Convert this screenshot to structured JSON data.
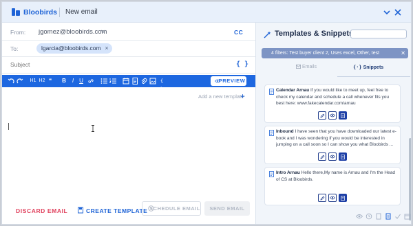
{
  "header": {
    "brand": "Bloobirds",
    "title": "New email",
    "icons": [
      "minimize-icon",
      "close-icon"
    ]
  },
  "compose": {
    "from_label": "From:",
    "from_value": "jgomez@bloobirds.com",
    "cc_label": "CC",
    "to_label": "To:",
    "to_chip": "lgarcia@bloobirds.com",
    "to_chip_remove": "×",
    "subject_placeholder": "Subject",
    "variables_label": "{ }",
    "toolbar": {
      "undo": "undo-icon",
      "redo": "redo-icon",
      "h1": "H1",
      "h2": "H2",
      "quote": "❝",
      "bold": "B",
      "italic": "I",
      "underline": "U",
      "preview_label": "PREVIEW"
    },
    "add_template_label": "Add a new template",
    "add_template_plus": "+",
    "discard_label": "DISCARD EMAIL",
    "create_template_label": "CREATE TEMPLATE",
    "schedule_label": "SCHEDULE EMAIL",
    "send_label": "SEND EMAIL"
  },
  "panel": {
    "title": "Templates & Snippets",
    "search_placeholder": "",
    "filters_text": "4 filters: Test buyer client 2, Uses excel, Other, test",
    "filters_close": "✕",
    "tabs": [
      {
        "label": "Emails",
        "active": false
      },
      {
        "label": "Snippets",
        "active": true
      }
    ],
    "cards": [
      {
        "title": "Calendar Arnau",
        "body": "If you would like to meet up, feel free to check my calendar and schedule a call whenever fits you best here: www.fakecalendar.com/arnau"
      },
      {
        "title": "Inbound",
        "body": "I have seen that you have downloaded our latest e-book and I was wondering if you would be interested in jumping on a call soon so I can show you what Bloobirds ..."
      },
      {
        "title": "Intro Arnau",
        "body": "Hello there,My name is Arnau and I'm the Head of CS at Bloobirds."
      }
    ]
  },
  "colors": {
    "accent": "#1d67e0",
    "danger": "#e0405c",
    "header_bg": "#e8f0fb",
    "panel_bg": "#f1f5fa",
    "filter_pill": "#7d94c4"
  }
}
